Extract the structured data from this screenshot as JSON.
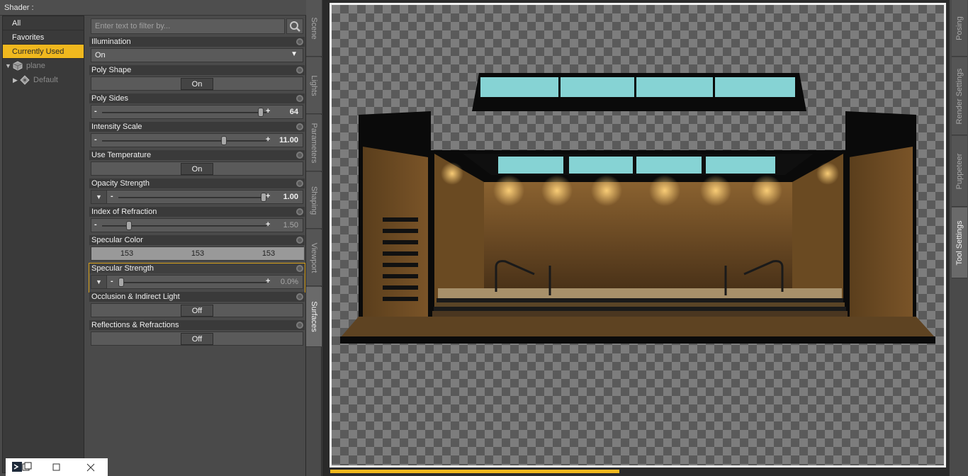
{
  "pane": {
    "title": "Shader :"
  },
  "filters": [
    {
      "label": "All",
      "selected": false
    },
    {
      "label": "Favorites",
      "selected": false
    },
    {
      "label": "Currently Used",
      "selected": true
    }
  ],
  "tree": [
    {
      "label": "plane",
      "icon": "cube-icon",
      "depth": 0
    },
    {
      "label": "Default",
      "icon": "material-icon",
      "depth": 1
    }
  ],
  "search": {
    "placeholder": "Enter text to filter by..."
  },
  "properties": {
    "illumination": {
      "label": "Illumination",
      "value": "On"
    },
    "poly_shape": {
      "label": "Poly Shape",
      "value": "On"
    },
    "poly_sides": {
      "label": "Poly Sides",
      "value": "64",
      "fraction": 0.98
    },
    "intensity_scale": {
      "label": "Intensity Scale",
      "value": "11.00",
      "fraction": 0.75
    },
    "use_temperature": {
      "label": "Use Temperature",
      "value": "On"
    },
    "opacity_strength": {
      "label": "Opacity Strength",
      "value": "1.00",
      "fraction": 1.0
    },
    "index_of_refraction": {
      "label": "Index of Refraction",
      "value": "1.50",
      "fraction": 0.15
    },
    "specular_color": {
      "label": "Specular Color",
      "r": "153",
      "g": "153",
      "b": "153",
      "hex": "#999999"
    },
    "specular_strength": {
      "label": "Specular Strength",
      "value": "0.0%",
      "fraction": 0.0
    },
    "occlusion": {
      "label": "Occlusion & Indirect Light",
      "value": "Off"
    },
    "reflections": {
      "label": "Reflections & Refractions",
      "value": "Off"
    }
  },
  "tabs": [
    "Scene",
    "Lights",
    "Parameters",
    "Shaping",
    "Viewport",
    "Surfaces"
  ],
  "right_tabs": [
    "Posing",
    "Render Settings",
    "Puppeteer",
    "Tool Settings"
  ],
  "render": {
    "progress": 0.47
  },
  "colors": {
    "accent": "#f0b81e",
    "pool_glass": "#86d3d4",
    "wood": "#6b4a24"
  }
}
